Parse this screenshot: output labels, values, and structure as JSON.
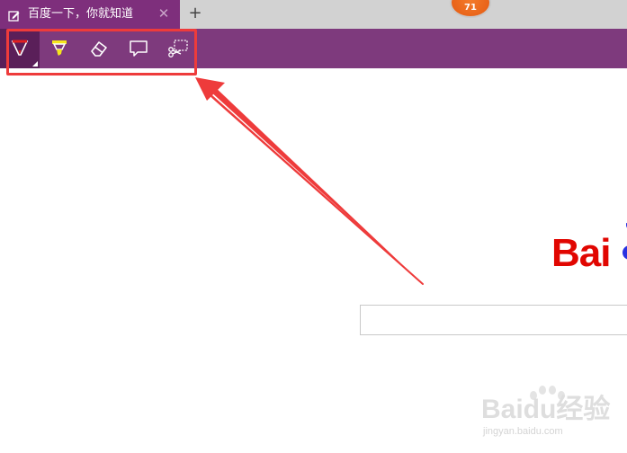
{
  "tab": {
    "title": "百度一下，你就知道",
    "close_symbol": "✕",
    "new_tab_symbol": "+",
    "icon": "edit-note-icon"
  },
  "notification_badge": {
    "count": "71"
  },
  "toolbar": {
    "tools": [
      {
        "name": "pen",
        "icon": "pen-icon",
        "active": true
      },
      {
        "name": "highlighter",
        "icon": "highlighter-icon",
        "active": false
      },
      {
        "name": "eraser",
        "icon": "eraser-icon",
        "active": false
      },
      {
        "name": "add-note",
        "icon": "comment-icon",
        "active": false
      },
      {
        "name": "clip",
        "icon": "scissors-icon",
        "active": false
      }
    ]
  },
  "page": {
    "logo_text": "Bai",
    "search": {
      "value": "",
      "placeholder": ""
    }
  },
  "watermark": {
    "main": "Baidu经验",
    "sub": "jingyan.baidu.com"
  },
  "colors": {
    "tab_purple": "#7e2f7c",
    "toolbar_purple": "#7e3a7d",
    "annotation_red": "#ee3b3b",
    "baidu_red": "#e10601",
    "baidu_blue": "#2932e1"
  }
}
